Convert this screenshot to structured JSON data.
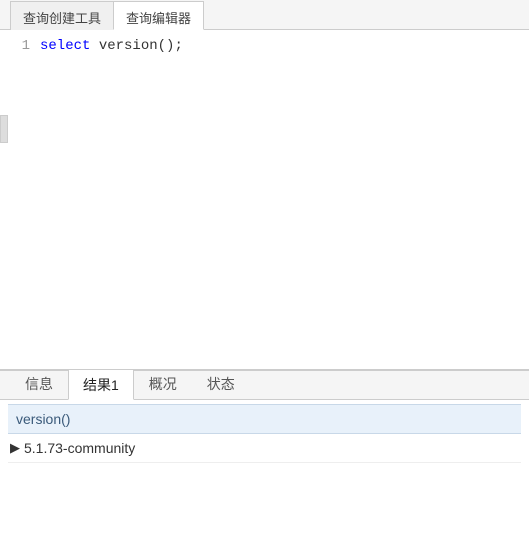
{
  "topTabs": {
    "builder": "查询创建工具",
    "editor": "查询编辑器",
    "activeIndex": 1
  },
  "editor": {
    "lineNumber": "1",
    "code": {
      "keyword": "select",
      "func": "version",
      "parenOpen": "(",
      "parenClose": ")",
      "semicolon": ";"
    }
  },
  "resultTabs": {
    "info": "信息",
    "result1": "结果1",
    "profile": "概况",
    "status": "状态",
    "activeIndex": 1
  },
  "resultGrid": {
    "columnHeader": "version()",
    "rows": [
      {
        "indicator": "▶",
        "value": "5.1.73-community"
      }
    ]
  }
}
